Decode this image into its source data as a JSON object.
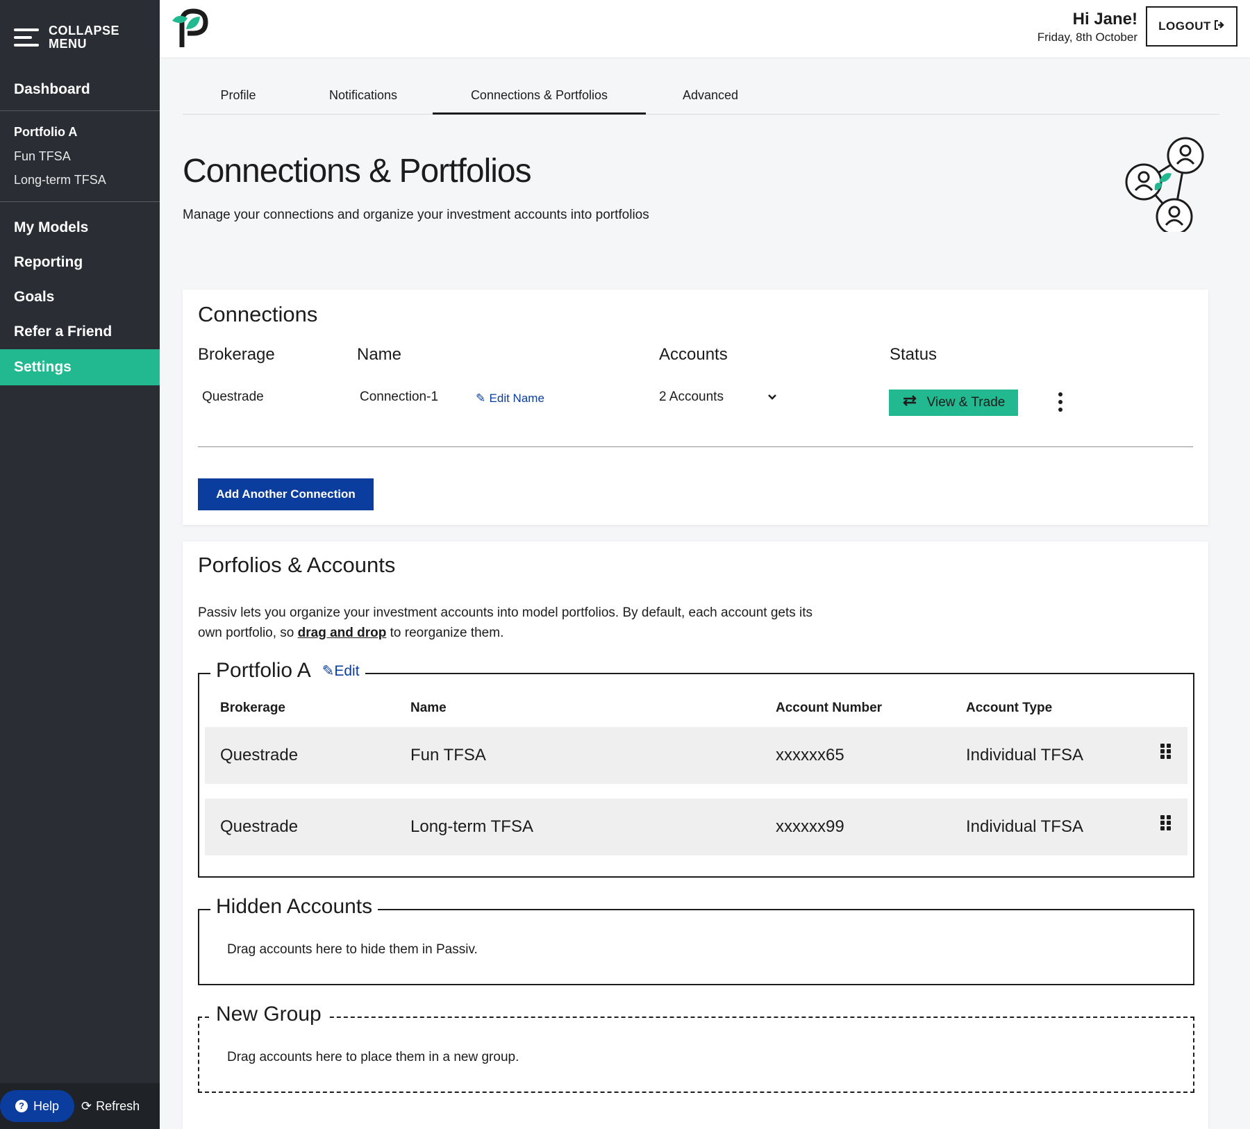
{
  "sidebar": {
    "collapse_label": "COLLAPSE MENU",
    "dashboard": "Dashboard",
    "portfolio_group": {
      "title": "Portfolio A",
      "items": [
        "Fun TFSA",
        "Long-term TFSA"
      ]
    },
    "items": [
      {
        "label": "My Models"
      },
      {
        "label": "Reporting"
      },
      {
        "label": "Goals"
      },
      {
        "label": "Refer a Friend"
      },
      {
        "label": "Settings",
        "active": true
      }
    ],
    "help": "Help",
    "refresh": "Refresh"
  },
  "header": {
    "greeting": "Hi Jane!",
    "date": "Friday, 8th October",
    "logout": "LOGOUT"
  },
  "tabs": [
    "Profile",
    "Notifications",
    "Connections & Portfolios",
    "Advanced"
  ],
  "active_tab": "Connections & Portfolios",
  "page": {
    "title": "Connections & Portfolios",
    "subtitle": "Manage your connections and organize your investment accounts into portfolios"
  },
  "connections": {
    "title": "Connections",
    "headers": [
      "Brokerage",
      "Name",
      "Accounts",
      "Status"
    ],
    "row": {
      "brokerage": "Questrade",
      "name": "Connection-1",
      "edit_name": "Edit Name",
      "accounts": "2 Accounts",
      "status_button": "View & Trade"
    },
    "add_button": "Add Another Connection"
  },
  "portfolios": {
    "title": "Porfolios & Accounts",
    "desc_part1": "Passiv lets you organize your investment accounts into model portfolios. By default, each account gets its own portfolio, so ",
    "desc_link": "drag and drop",
    "desc_part2": " to reorganize them.",
    "group": {
      "name": "Portfolio A",
      "edit": "Edit",
      "headers": [
        "Brokerage",
        "Name",
        "Account Number",
        "Account Type"
      ],
      "rows": [
        {
          "brokerage": "Questrade",
          "name": "Fun TFSA",
          "number": "xxxxxx65",
          "type": "Individual TFSA"
        },
        {
          "brokerage": "Questrade",
          "name": "Long-term TFSA",
          "number": "xxxxxx99",
          "type": "Individual TFSA"
        }
      ]
    },
    "hidden": {
      "title": "Hidden Accounts",
      "text": "Drag accounts here to hide them in Passiv."
    },
    "new_group": {
      "title": "New Group",
      "text": "Drag accounts here to place them in a new group."
    }
  },
  "colors": {
    "sidebar_bg": "#2a2d33",
    "accent_green": "#22b890",
    "primary_blue": "#0a3d9e"
  }
}
